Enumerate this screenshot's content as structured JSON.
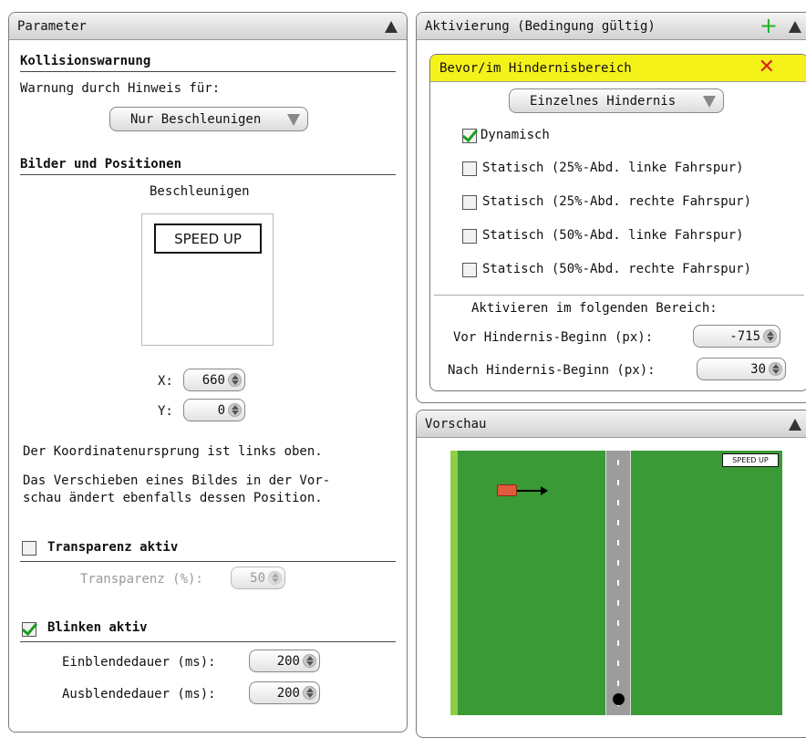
{
  "left": {
    "title": "Parameter",
    "kollision_heading": "Kollisionswarnung",
    "warnung_label": "Warnung durch Hinweis für:",
    "warnung_value": "Nur Beschleunigen",
    "bilder_heading": "Bilder und Positionen",
    "image_caption": "Beschleunigen",
    "image_text": "SPEED UP",
    "x_label": "X:",
    "x_value": "660",
    "y_label": "Y:",
    "y_value": "0",
    "info1": "Der Koordinatenursprung ist links oben.",
    "info2a": "Das Verschieben eines Bildes in der Vor-",
    "info2b": "schau ändert ebenfalls dessen Position.",
    "transparenz_heading": "Transparenz aktiv",
    "transparenz_checked": false,
    "transparenz_label": "Transparenz (%):",
    "transparenz_value": "50",
    "blinken_heading": "Blinken aktiv",
    "blinken_checked": true,
    "einblend_label": "Einblendedauer (ms):",
    "einblend_value": "200",
    "ausblend_label": "Ausblendedauer (ms):",
    "ausblend_value": "200"
  },
  "activation": {
    "title": "Aktivierung (Bedingung gültig)",
    "add_icon": "plus-icon",
    "condition_title": "Bevor/im Hindernisbereich",
    "delete_icon": "close-icon",
    "obstacle_mode": "Einzelnes Hindernis",
    "options": [
      {
        "label": "Dynamisch",
        "checked": true
      },
      {
        "label": "Statisch (25%-Abd. linke Fahrspur)",
        "checked": false
      },
      {
        "label": "Statisch (25%-Abd. rechte Fahrspur)",
        "checked": false
      },
      {
        "label": "Statisch (50%-Abd. linke Fahrspur)",
        "checked": false
      },
      {
        "label": "Statisch (50%-Abd. rechte Fahrspur)",
        "checked": false
      }
    ],
    "range_heading": "Aktivieren im folgenden Bereich:",
    "vor_label": "Vor Hindernis-Beginn (px):",
    "vor_value": "-715",
    "nach_label": "Nach Hindernis-Beginn (px):",
    "nach_value": "30"
  },
  "preview": {
    "title": "Vorschau",
    "sign_text": "SPEED UP"
  },
  "colors": {
    "grass": "#3a9a36",
    "road": "#9c9c9c",
    "condition_header": "#f5f21a",
    "add_green": "#22b322",
    "delete_red": "#e02020",
    "check_green": "#1a9e1a"
  }
}
